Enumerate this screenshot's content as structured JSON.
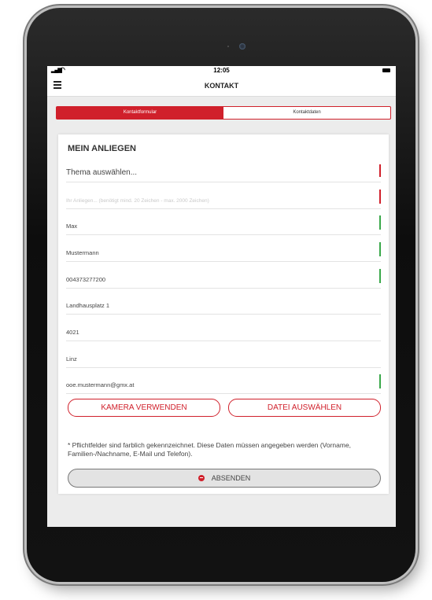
{
  "statusbar": {
    "time": "12:05"
  },
  "navbar": {
    "title": "KONTAKT"
  },
  "tabs": [
    {
      "label": "Kontaktformular",
      "active": true
    },
    {
      "label": "Kontaktdaten",
      "active": false
    }
  ],
  "form": {
    "heading": "MEIN ANLIEGEN",
    "fields": [
      {
        "name": "topic-select",
        "value": "Thema auswählen...",
        "placeholder": "",
        "status": "required-empty"
      },
      {
        "name": "message-field",
        "value": "",
        "placeholder": "Ihr Anliegen... (benötigt mind. 20 Zeichen - max. 2000 Zeichen)",
        "status": "required-empty"
      },
      {
        "name": "first-name-field",
        "value": "Max",
        "status": "valid"
      },
      {
        "name": "last-name-field",
        "value": "Mustermann",
        "status": "valid"
      },
      {
        "name": "phone-field",
        "value": "004373277200",
        "status": "valid"
      },
      {
        "name": "street-field",
        "value": "Landhausplatz 1",
        "status": "optional"
      },
      {
        "name": "zip-field",
        "value": "4021",
        "status": "optional"
      },
      {
        "name": "city-field",
        "value": "Linz",
        "status": "optional"
      },
      {
        "name": "email-field",
        "value": "ooe.mustermann@gmx.at",
        "status": "valid"
      }
    ],
    "camera_button": "KAMERA VERWENDEN",
    "file_button": "DATEI AUSWÄHLEN",
    "note": "* Pflichtfelder sind farblich gekennzeichnet. Diese Daten müssen angegeben werden (Vorname, Familien-/Nachname, E-Mail und Telefon).",
    "submit_button": "ABSENDEN"
  },
  "colors": {
    "accent": "#d0202b",
    "valid": "#3aa84a",
    "background": "#ececec"
  }
}
